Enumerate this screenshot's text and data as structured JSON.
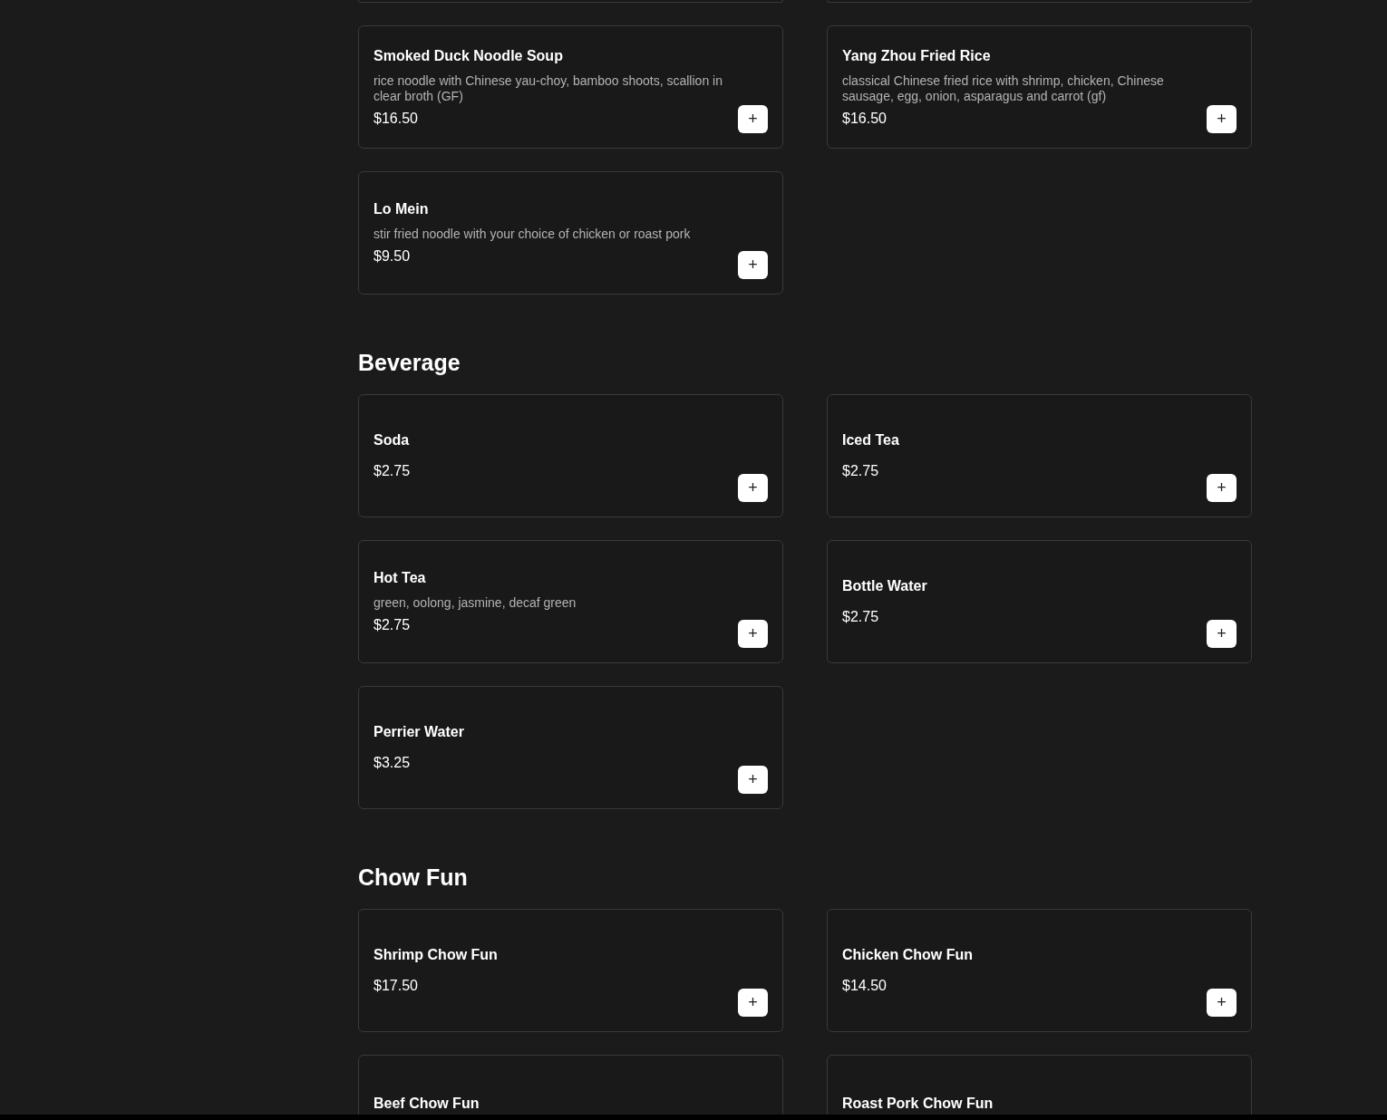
{
  "sections": [
    {
      "items": [
        {
          "name": "Smoked Duck Noodle Soup",
          "description": "rice noodle with Chinese yau-choy, bamboo shoots, scallion in clear broth (GF)",
          "price": "$16.50",
          "button": "+"
        },
        {
          "name": "Yang Zhou Fried Rice",
          "description": "classical Chinese fried rice with shrimp, chicken, Chinese sausage, egg, onion, asparagus and carrot (gf)",
          "price": "$16.50",
          "button": "+"
        },
        {
          "name": "Lo Mein",
          "description": "stir fried noodle with your choice of chicken or roast pork",
          "price": "$9.50",
          "button": "+"
        }
      ]
    },
    {
      "title": "Beverage",
      "items": [
        {
          "name": "Soda",
          "price": "$2.75",
          "button": "+"
        },
        {
          "name": "Iced Tea",
          "price": "$2.75",
          "button": "+"
        },
        {
          "name": "Hot Tea",
          "description": "green, oolong, jasmine, decaf green",
          "price": "$2.75",
          "button": "+"
        },
        {
          "name": "Bottle Water",
          "price": "$2.75",
          "button": "+"
        },
        {
          "name": "Perrier Water",
          "price": "$3.25",
          "button": "+"
        }
      ]
    },
    {
      "title": "Chow Fun",
      "items": [
        {
          "name": "Shrimp Chow Fun",
          "price": "$17.50",
          "button": "+"
        },
        {
          "name": "Chicken Chow Fun",
          "price": "$14.50",
          "button": "+"
        },
        {
          "name": "Beef Chow Fun"
        },
        {
          "name": "Roast Pork Chow Fun"
        }
      ]
    }
  ]
}
